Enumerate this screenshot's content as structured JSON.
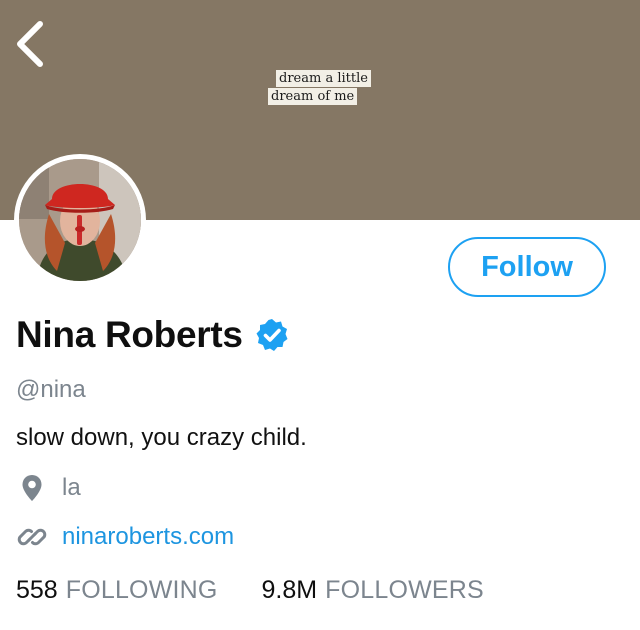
{
  "colors": {
    "banner": "#857764",
    "accent": "#1da1f2",
    "link": "#1d95e0",
    "secondary_text": "#7c858e",
    "primary_text": "#0f0f0f"
  },
  "header": {
    "back_icon": "chevron-left-icon",
    "banner_note": {
      "line1": "dream a little",
      "line2": "dream of me"
    }
  },
  "actions": {
    "follow_label": "Follow"
  },
  "profile": {
    "name": "Nina Roberts",
    "verified_icon": "verified-badge-icon",
    "handle": "@nina",
    "bio": "slow down, you crazy child.",
    "location": {
      "icon": "location-pin-icon",
      "text": "la"
    },
    "website": {
      "icon": "link-icon",
      "text": "ninaroberts.com"
    }
  },
  "stats": {
    "following": {
      "value": "558",
      "label": "FOLLOWING"
    },
    "followers": {
      "value": "9.8M",
      "label": "FOLLOWERS"
    }
  }
}
